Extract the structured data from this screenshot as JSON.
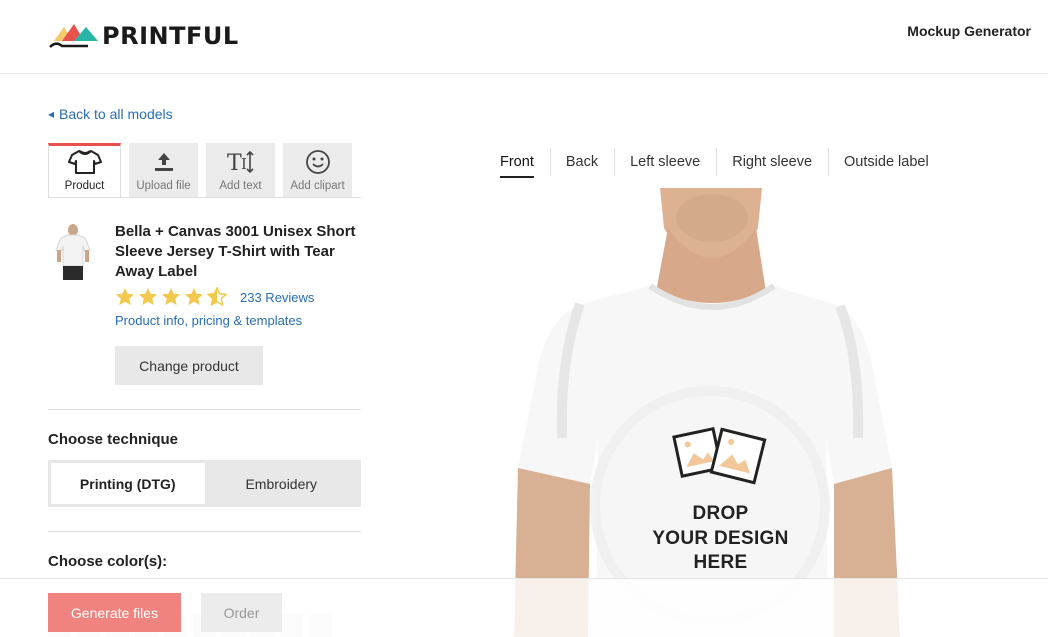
{
  "header": {
    "logo_text": "PRINTFUL",
    "right_title": "Mockup Generator"
  },
  "nav": {
    "back_link": "Back to all models"
  },
  "tools": [
    {
      "label": "Product",
      "icon": "tshirt-icon",
      "active": true
    },
    {
      "label": "Upload file",
      "icon": "upload-icon",
      "active": false
    },
    {
      "label": "Add text",
      "icon": "text-icon",
      "active": false
    },
    {
      "label": "Add clipart",
      "icon": "smiley-icon",
      "active": false
    }
  ],
  "product": {
    "name": "Bella + Canvas 3001 Unisex Short Sleeve Jersey T-Shirt with Tear Away Label",
    "rating": 4.5,
    "reviews_label": "233 Reviews",
    "info_link": "Product info, pricing & templates",
    "change_button": "Change product"
  },
  "technique": {
    "title": "Choose technique",
    "options": [
      "Printing (DTG)",
      "Embroidery"
    ],
    "selected": "Printing (DTG)"
  },
  "colors": {
    "title": "Choose color(s):"
  },
  "views": {
    "tabs": [
      "Front",
      "Back",
      "Left sleeve",
      "Right sleeve",
      "Outside label"
    ],
    "active": "Front"
  },
  "mockup": {
    "drop_text_line1": "DROP",
    "drop_text_line2": "YOUR DESIGN",
    "drop_text_line3": "HERE"
  },
  "actions": {
    "generate_label": "Generate files",
    "order_label": "Order"
  },
  "colors_palette": {
    "accent": "#e8514c",
    "link": "#2a6db5",
    "star": "#f2c94c",
    "generate_button": "#f0837f"
  }
}
